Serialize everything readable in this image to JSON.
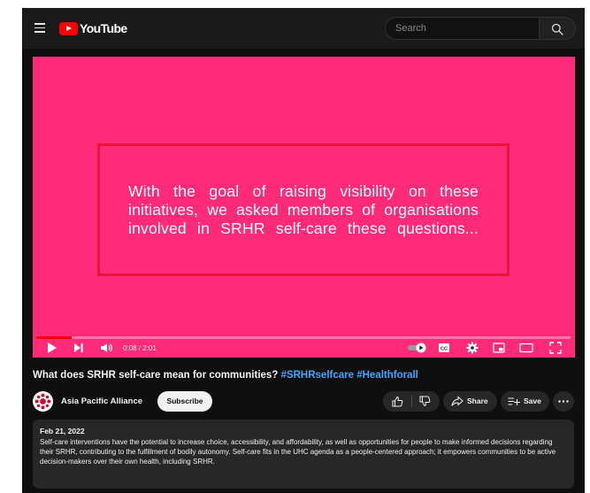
{
  "header": {
    "logo_text": "YouTube",
    "search_placeholder": "Search"
  },
  "player": {
    "slide_text": "With the goal of raising visibility on these initiatives, we asked members of organisations involved in SRHR self-care these questions...",
    "time": "0:08 / 2:01",
    "progress": 0.066,
    "colors": {
      "background": "#ff2b78",
      "box_border": "#e8143c",
      "progress": "#ff0000"
    }
  },
  "video": {
    "title": "What does SRHR self-care mean for communities?",
    "hashtags": [
      "#SRHRselfcare",
      "#Healthforall"
    ]
  },
  "channel": {
    "name": "Asia Pacific Alliance",
    "subscribe_label": "Subscribe"
  },
  "actions": {
    "share_label": "Share",
    "save_label": "Save"
  },
  "description": {
    "date": "Feb 21, 2022",
    "text": "Self-care interventions have the potential to increase choice, accessibility, and affordability, as well as opportunities for people to make informed decisions regarding their SRHR, contributing to the fulfillment of bodily autonomy.  Self-care fits in the UHC agenda as a people-centered approach; it empowers communities to be active decision-makers over their own health, including SRHR."
  },
  "colors": {
    "accent_link": "#3ea6ff",
    "brand_red": "#ff0000",
    "page_bg": "#0f0f0f"
  }
}
